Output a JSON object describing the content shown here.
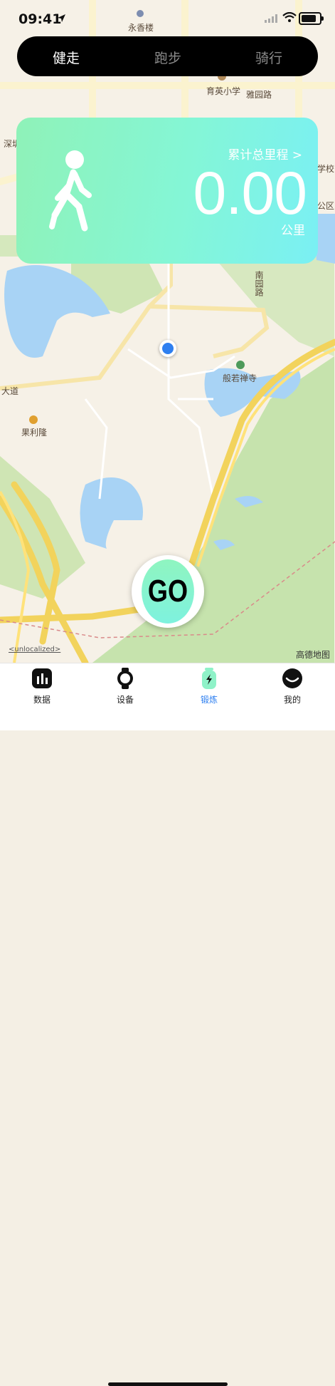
{
  "status_bar": {
    "time": "09:41"
  },
  "modes": [
    {
      "label": "健走",
      "active": true
    },
    {
      "label": "跑步",
      "active": false
    },
    {
      "label": "骑行",
      "active": false
    }
  ],
  "stats_card": {
    "cumulative_label": "累计总里程 >",
    "distance": "0.00",
    "unit": "公里"
  },
  "map_labels": {
    "yongxianglou": "永香楼",
    "yuying": "育英小学",
    "yayuan": "雅园路",
    "shenzhen": "深圳",
    "school": "学校",
    "district": "公区",
    "jiaoyuanlu": "南园路",
    "banruo": "般若禅寺",
    "dadao": "大道",
    "guolilong": "果利隆"
  },
  "map": {
    "attribution": "<unlocalized>",
    "provider": "高德地图"
  },
  "go_button": {
    "label": "GO"
  },
  "tabs": [
    {
      "label": "数据",
      "icon": "bar-chart-icon",
      "active": false
    },
    {
      "label": "设备",
      "icon": "watch-icon",
      "active": false
    },
    {
      "label": "锻炼",
      "icon": "bolt-icon",
      "active": true
    },
    {
      "label": "我的",
      "icon": "profile-face-icon",
      "active": false
    }
  ],
  "colors": {
    "accent": "#2e7ff0",
    "card_start": "#8ff2b8",
    "card_end": "#7af0f4",
    "mode_bar": "#000000"
  }
}
